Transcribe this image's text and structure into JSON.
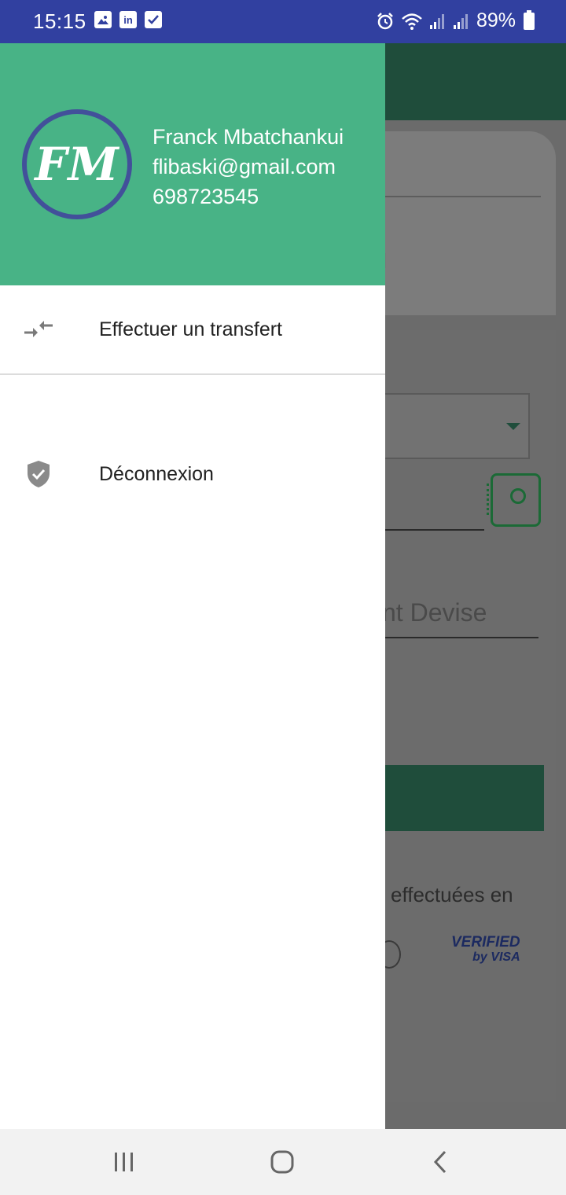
{
  "status_bar": {
    "time": "15:15",
    "battery": "89%",
    "left_icons": [
      "gallery-icon",
      "linkedin-icon",
      "checkbox-icon"
    ],
    "right_icons": [
      "alarm-icon",
      "wifi-icon",
      "signal-icon",
      "signal-icon",
      "battery-icon"
    ]
  },
  "background": {
    "partial_label": "l",
    "amount_placeholder": "nt Devise",
    "payment_text": "effectuées en",
    "visa_badge_line1": "VERIFIED",
    "visa_badge_line2": "by VISA"
  },
  "drawer": {
    "avatar_initials": "FM",
    "user_name": "Franck Mbatchankui",
    "user_email": "flibaski@gmail.com",
    "user_phone": "698723545",
    "items": [
      {
        "label": "Effectuer un transfert",
        "icon": "transfer-arrows-icon"
      },
      {
        "label": "Déconnexion",
        "icon": "shield-check-icon"
      }
    ]
  },
  "colors": {
    "status_bar": "#3140a0",
    "drawer_header": "#48b386",
    "toolbar": "#1f4d3b",
    "avatar_ring": "#42509a"
  },
  "nav_bar": {
    "buttons": [
      "recents-icon",
      "home-icon",
      "back-icon"
    ]
  }
}
